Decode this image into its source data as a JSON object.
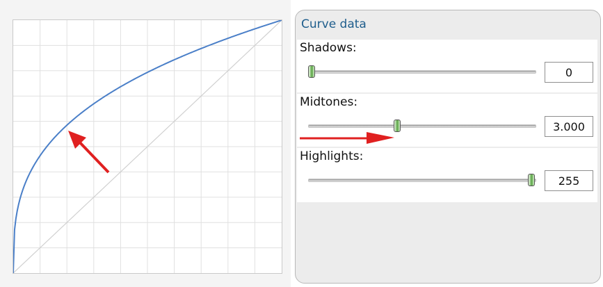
{
  "panel": {
    "title": "Curve data",
    "shadows": {
      "label": "Shadows:",
      "value": "0",
      "position": 0.0
    },
    "midtones": {
      "label": "Midtones:",
      "value": "3.000",
      "position": 0.39
    },
    "highlights": {
      "label": "Highlights:",
      "value": "255",
      "position": 1.0
    }
  },
  "curve": {
    "gamma": 3.0
  },
  "colors": {
    "curve": "#4a7fc8",
    "diagonal": "#d0d0d0",
    "grid": "#e0e0e0",
    "arrow": "#e02020",
    "title": "#1e5d8c"
  }
}
